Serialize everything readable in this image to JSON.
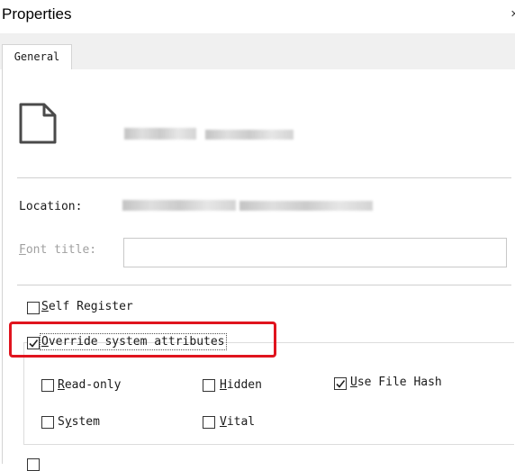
{
  "window": {
    "title": "Properties",
    "close_glyph": "×"
  },
  "tabs": [
    {
      "label": "General",
      "selected": true
    }
  ],
  "general": {
    "location_label": "Location:",
    "font_title_label_underlined": "F",
    "font_title_label_rest": "ont title:",
    "font_title_value": ""
  },
  "options": {
    "self_register": {
      "label_u": "S",
      "label_rest": "elf Register",
      "checked": false
    },
    "override": {
      "label_u": "O",
      "label_rest": "verride system attributes",
      "checked": true
    },
    "read_only": {
      "label_u": "R",
      "label_rest": "ead-only",
      "checked": false
    },
    "hidden": {
      "label_u": "H",
      "label_rest": "idden",
      "checked": false
    },
    "use_file_hash": {
      "label_u": "U",
      "label_rest": "se File Hash",
      "checked": true
    },
    "system": {
      "label_u": "",
      "label_pre": "S",
      "label_u2": "y",
      "label_rest": "stem",
      "checked": false
    },
    "vital": {
      "label_u": "V",
      "label_rest": "ital",
      "checked": false
    }
  },
  "icons": {
    "file": "file-icon",
    "checkmark": "checkmark-icon"
  },
  "colors": {
    "highlight": "#e0141e",
    "tab_strip": "#f0f0f0"
  }
}
